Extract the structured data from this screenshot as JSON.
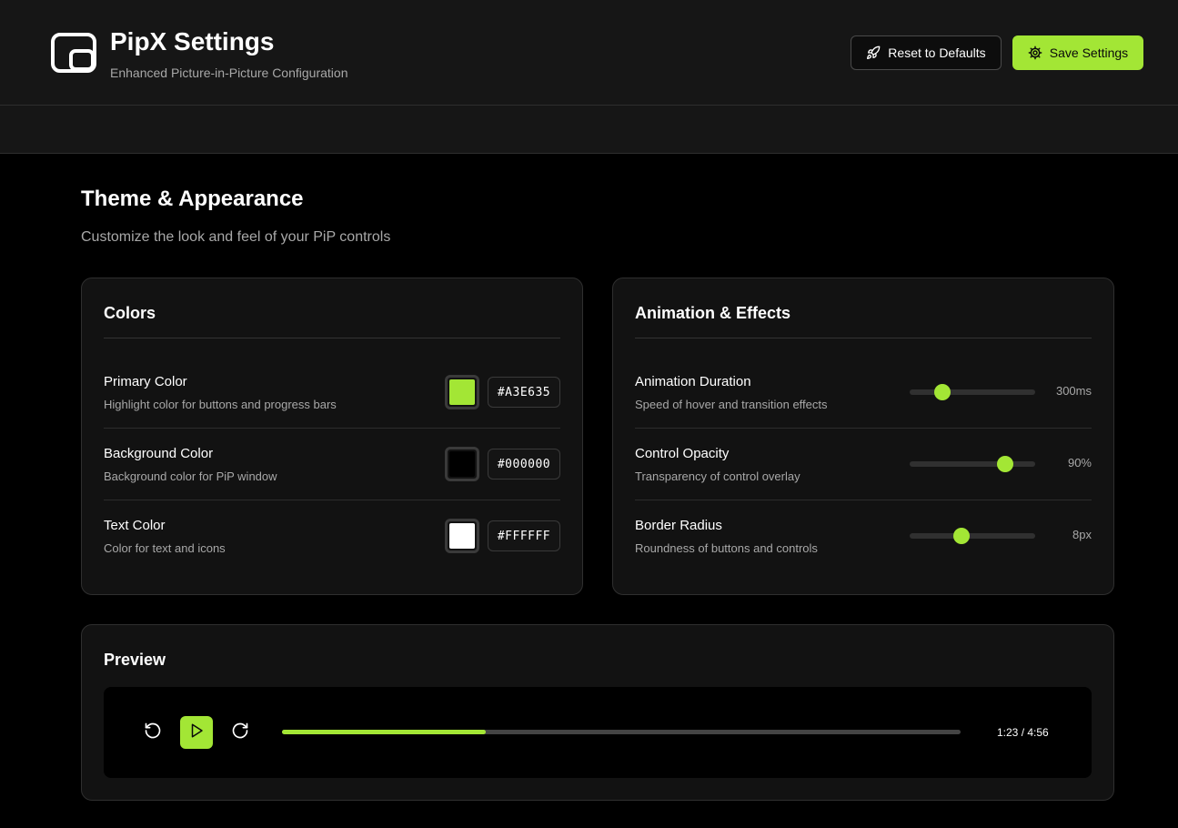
{
  "header": {
    "title": "PipX Settings",
    "subtitle": "Enhanced Picture-in-Picture Configuration",
    "reset_label": "Reset to Defaults",
    "save_label": "Save Settings",
    "logo_icon": "picture-in-picture-icon",
    "reset_icon": "rocket-icon",
    "save_icon": "gear-icon"
  },
  "section": {
    "title": "Theme & Appearance",
    "description": "Customize the look and feel of your PiP controls"
  },
  "colors_card": {
    "title": "Colors",
    "rows": [
      {
        "label": "Primary Color",
        "help": "Highlight color for buttons and progress bars",
        "hex": "#A3E635",
        "color": "#a3e635"
      },
      {
        "label": "Background Color",
        "help": "Background color for PiP window",
        "hex": "#000000",
        "color": "#000000"
      },
      {
        "label": "Text Color",
        "help": "Color for text and icons",
        "hex": "#FFFFFF",
        "color": "#ffffff"
      }
    ]
  },
  "animation_card": {
    "title": "Animation & Effects",
    "rows": [
      {
        "label": "Animation Duration",
        "help": "Speed of hover and transition effects",
        "value": "300ms",
        "level": 0.26
      },
      {
        "label": "Control Opacity",
        "help": "Transparency of control overlay",
        "value": "90%",
        "level": 0.76
      },
      {
        "label": "Border Radius",
        "help": "Roundness of buttons and controls",
        "value": "8px",
        "level": 0.41
      }
    ]
  },
  "preview": {
    "title": "Preview",
    "time": "1:23 / 4:56",
    "progress": 0.3,
    "back_icon": "rewind-icon",
    "play_icon": "play-icon",
    "forward_icon": "fast-forward-icon"
  },
  "theme": {
    "accent": "#a3e635",
    "background": "#000000",
    "surface": "#121212",
    "header": "#161616"
  }
}
